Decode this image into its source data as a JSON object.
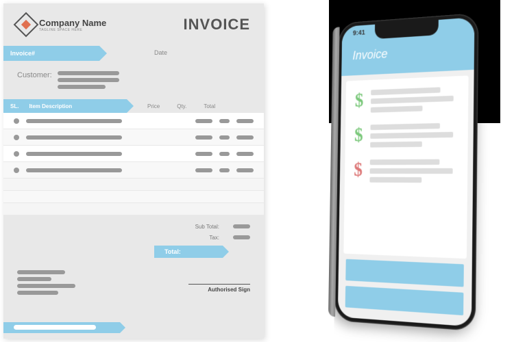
{
  "paper": {
    "company_name": "Company Name",
    "company_tagline": "TAGLINE SPACE HERE",
    "title": "INVOICE",
    "invoice_num_label": "Invoice#",
    "date_label": "Date",
    "customer_label": "Customer:",
    "columns": {
      "sl": "SL.",
      "desc": "Item Description",
      "price": "Price",
      "qty": "Qty.",
      "total": "Total"
    },
    "subtotal_label": "Sub Total:",
    "tax_label": "Tax:",
    "total_label": "Total:",
    "sign_label": "Authorised Sign"
  },
  "phone": {
    "time": "9:41",
    "header": "Invoice"
  }
}
